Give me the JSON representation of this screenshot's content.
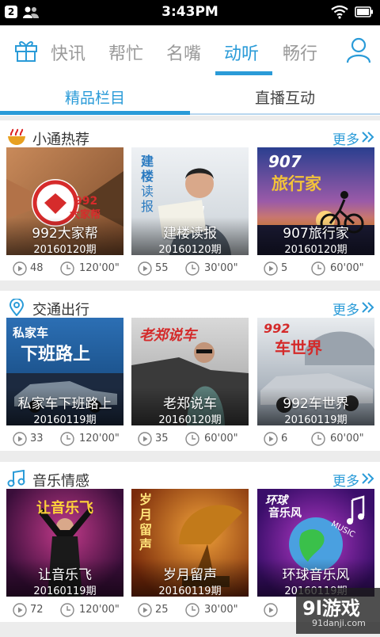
{
  "status_bar": {
    "notification_count": "2",
    "time": "3:43PM"
  },
  "top_nav": {
    "items": [
      "快讯",
      "帮忙",
      "名嘴",
      "动听",
      "畅行"
    ],
    "active_index": 3
  },
  "sub_tabs": {
    "items": [
      "精品栏目",
      "直播互动"
    ],
    "active_index": 0
  },
  "colors": {
    "accent": "#2a9bd8"
  },
  "sections": [
    {
      "title": "小通热荐",
      "icon": "hot-bowl-icon",
      "more_label": "更多",
      "cards": [
        {
          "title": "992大家帮",
          "date": "20160120期",
          "plays": "48",
          "duration": "120'00\""
        },
        {
          "title": "建楼读报",
          "date": "20160120期",
          "plays": "55",
          "duration": "30'00\""
        },
        {
          "title": "907旅行家",
          "date": "20160120期",
          "plays": "5",
          "duration": "60'00\""
        }
      ]
    },
    {
      "title": "交通出行",
      "icon": "location-pin-icon",
      "more_label": "更多",
      "cards": [
        {
          "title": "私家车下班路上",
          "date": "20160119期",
          "plays": "33",
          "duration": "120'00\""
        },
        {
          "title": "老郑说车",
          "date": "20160120期",
          "plays": "35",
          "duration": "60'00\""
        },
        {
          "title": "992车世界",
          "date": "20160119期",
          "plays": "6",
          "duration": "60'00\""
        }
      ]
    },
    {
      "title": "音乐情感",
      "icon": "music-note-icon",
      "more_label": "更多",
      "cards": [
        {
          "title": "让音乐飞",
          "date": "20160119期",
          "plays": "72",
          "duration": "120'00\""
        },
        {
          "title": "岁月留声",
          "date": "20160119期",
          "plays": "25",
          "duration": "30'00\""
        },
        {
          "title": "环球音乐风",
          "date": "20160119期",
          "plays": "",
          "duration": ""
        }
      ]
    }
  ],
  "thumbnail_texts": {
    "s0c0": [
      "992",
      "大家帮"
    ],
    "s0c1": [
      "建",
      "楼",
      "读",
      "报"
    ],
    "s0c2": [
      "907",
      "旅行家"
    ],
    "s1c0": [
      "私家车",
      "下班路上"
    ],
    "s1c1": [
      "老郑说车"
    ],
    "s1c2": [
      "992",
      "车世界"
    ],
    "s2c0": [
      "让音乐飞"
    ],
    "s2c1": [
      "岁",
      "月",
      "留",
      "声"
    ],
    "s2c2": [
      "环球",
      "音乐风",
      "MUSIC"
    ]
  },
  "watermark": {
    "logo": "9l游戏",
    "url": "91danji.com"
  }
}
